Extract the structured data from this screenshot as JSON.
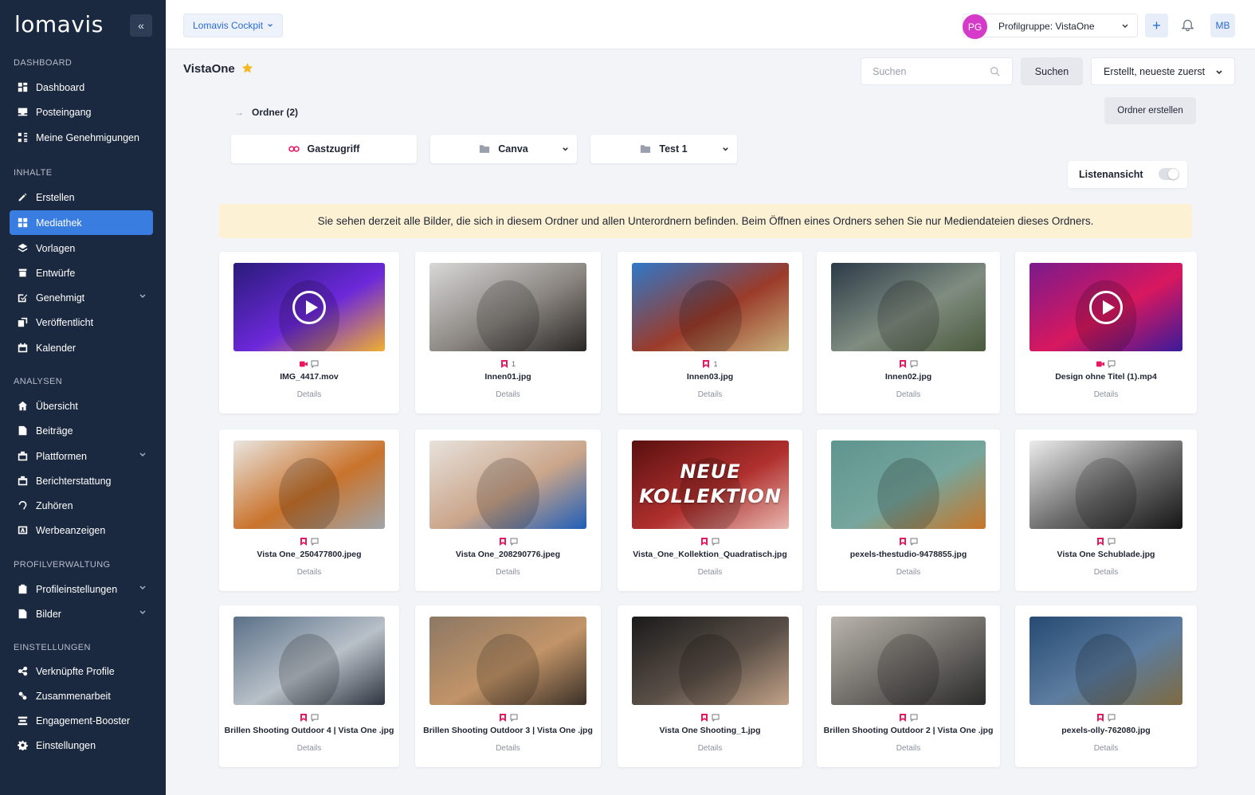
{
  "app": {
    "logo_text": "lomavis",
    "collapse_label": "«"
  },
  "sidebar": {
    "sections": [
      {
        "title": "DASHBOARD",
        "items": [
          {
            "label": "Dashboard",
            "icon": "dashboard-icon"
          },
          {
            "label": "Posteingang",
            "icon": "inbox-icon"
          },
          {
            "label": "Meine Genehmigungen",
            "icon": "approvals-icon"
          }
        ]
      },
      {
        "title": "INHALTE",
        "items": [
          {
            "label": "Erstellen",
            "icon": "create-icon"
          },
          {
            "label": "Mediathek",
            "icon": "media-library-icon",
            "active": true
          },
          {
            "label": "Vorlagen",
            "icon": "templates-icon"
          },
          {
            "label": "Entwürfe",
            "icon": "drafts-icon"
          },
          {
            "label": "Genehmigt",
            "icon": "approved-icon",
            "expandable": true
          },
          {
            "label": "Veröffentlicht",
            "icon": "published-icon"
          },
          {
            "label": "Kalender",
            "icon": "calendar-icon"
          }
        ]
      },
      {
        "title": "ANALYSEN",
        "items": [
          {
            "label": "Übersicht",
            "icon": "home-icon"
          },
          {
            "label": "Beiträge",
            "icon": "posts-icon"
          },
          {
            "label": "Plattformen",
            "icon": "platforms-icon",
            "expandable": true
          },
          {
            "label": "Berichterstattung",
            "icon": "reporting-icon"
          },
          {
            "label": "Zuhören",
            "icon": "listening-icon"
          },
          {
            "label": "Werbeanzeigen",
            "icon": "ads-icon"
          }
        ]
      },
      {
        "title": "PROFILVERWALTUNG",
        "items": [
          {
            "label": "Profileinstellungen",
            "icon": "profile-settings-icon",
            "expandable": true
          },
          {
            "label": "Bilder",
            "icon": "images-icon",
            "expandable": true
          }
        ]
      },
      {
        "title": "EINSTELLUNGEN",
        "items": [
          {
            "label": "Verknüpfte Profile",
            "icon": "linked-profiles-icon"
          },
          {
            "label": "Zusammenarbeit",
            "icon": "collaboration-icon"
          },
          {
            "label": "Engagement-Booster",
            "icon": "engagement-icon"
          },
          {
            "label": "Einstellungen",
            "icon": "gear-icon"
          }
        ]
      }
    ]
  },
  "header": {
    "cockpit_label": "Lomavis Cockpit",
    "profile_group_initials": "PG",
    "profile_group_label": "Profilgruppe: VistaOne",
    "plus_label": "+",
    "user_initials": "MB"
  },
  "main": {
    "title": "VistaOne",
    "search_placeholder": "Suchen",
    "search_button": "Suchen",
    "sort_label": "Erstellt, neueste zuerst",
    "breadcrumb_label": "Ordner (2)",
    "create_folder_label": "Ordner erstellen",
    "folders": [
      {
        "label": "Gastzugriff",
        "icon": "guest-link-icon"
      },
      {
        "label": "Canva",
        "icon": "folder-icon"
      },
      {
        "label": "Test 1",
        "icon": "folder-icon"
      }
    ],
    "list_view_label": "Listenansicht",
    "banner_text": "Sie sehen derzeit alle Bilder, die sich in diesem Ordner und allen Unterordnern befinden. Beim Öffnen eines Ordners sehen Sie nur Mediendateien dieses Ordners.",
    "details_label": "Details",
    "media": [
      {
        "name": "IMG_4417.mov",
        "type": "video",
        "count": ""
      },
      {
        "name": "Innen01.jpg",
        "type": "image",
        "count": "1"
      },
      {
        "name": "Innen03.jpg",
        "type": "image",
        "count": "1"
      },
      {
        "name": "Innen02.jpg",
        "type": "image",
        "count": ""
      },
      {
        "name": "Design ohne Titel (1).mp4",
        "type": "video",
        "count": ""
      },
      {
        "name": "Vista One_250477800.jpeg",
        "type": "image",
        "count": ""
      },
      {
        "name": "Vista One_208290776.jpeg",
        "type": "image",
        "count": ""
      },
      {
        "name": "Vista_One_Kollektion_Quadratisch.jpg",
        "type": "image",
        "count": "",
        "overlay_text": [
          "NEUE",
          "KOLLEKTION"
        ]
      },
      {
        "name": "pexels-thestudio-9478855.jpg",
        "type": "image",
        "count": ""
      },
      {
        "name": "Vista One Schublade.jpg",
        "type": "image",
        "count": ""
      },
      {
        "name": "Brillen Shooting Outdoor 4 | Vista One .jpg",
        "type": "image",
        "count": ""
      },
      {
        "name": "Brillen Shooting Outdoor 3 | Vista One .jpg",
        "type": "image",
        "count": ""
      },
      {
        "name": "Vista One Shooting_1.jpg",
        "type": "image",
        "count": ""
      },
      {
        "name": "Brillen Shooting Outdoor 2 | Vista One .jpg",
        "type": "image",
        "count": ""
      },
      {
        "name": "pexels-olly-762080.jpg",
        "type": "image",
        "count": ""
      }
    ]
  },
  "colors": {
    "sidebar_bg": "#1a2840",
    "accent": "#3a7de0",
    "brand_pink": "#e8185f",
    "banner_bg": "#fdf1d3"
  }
}
